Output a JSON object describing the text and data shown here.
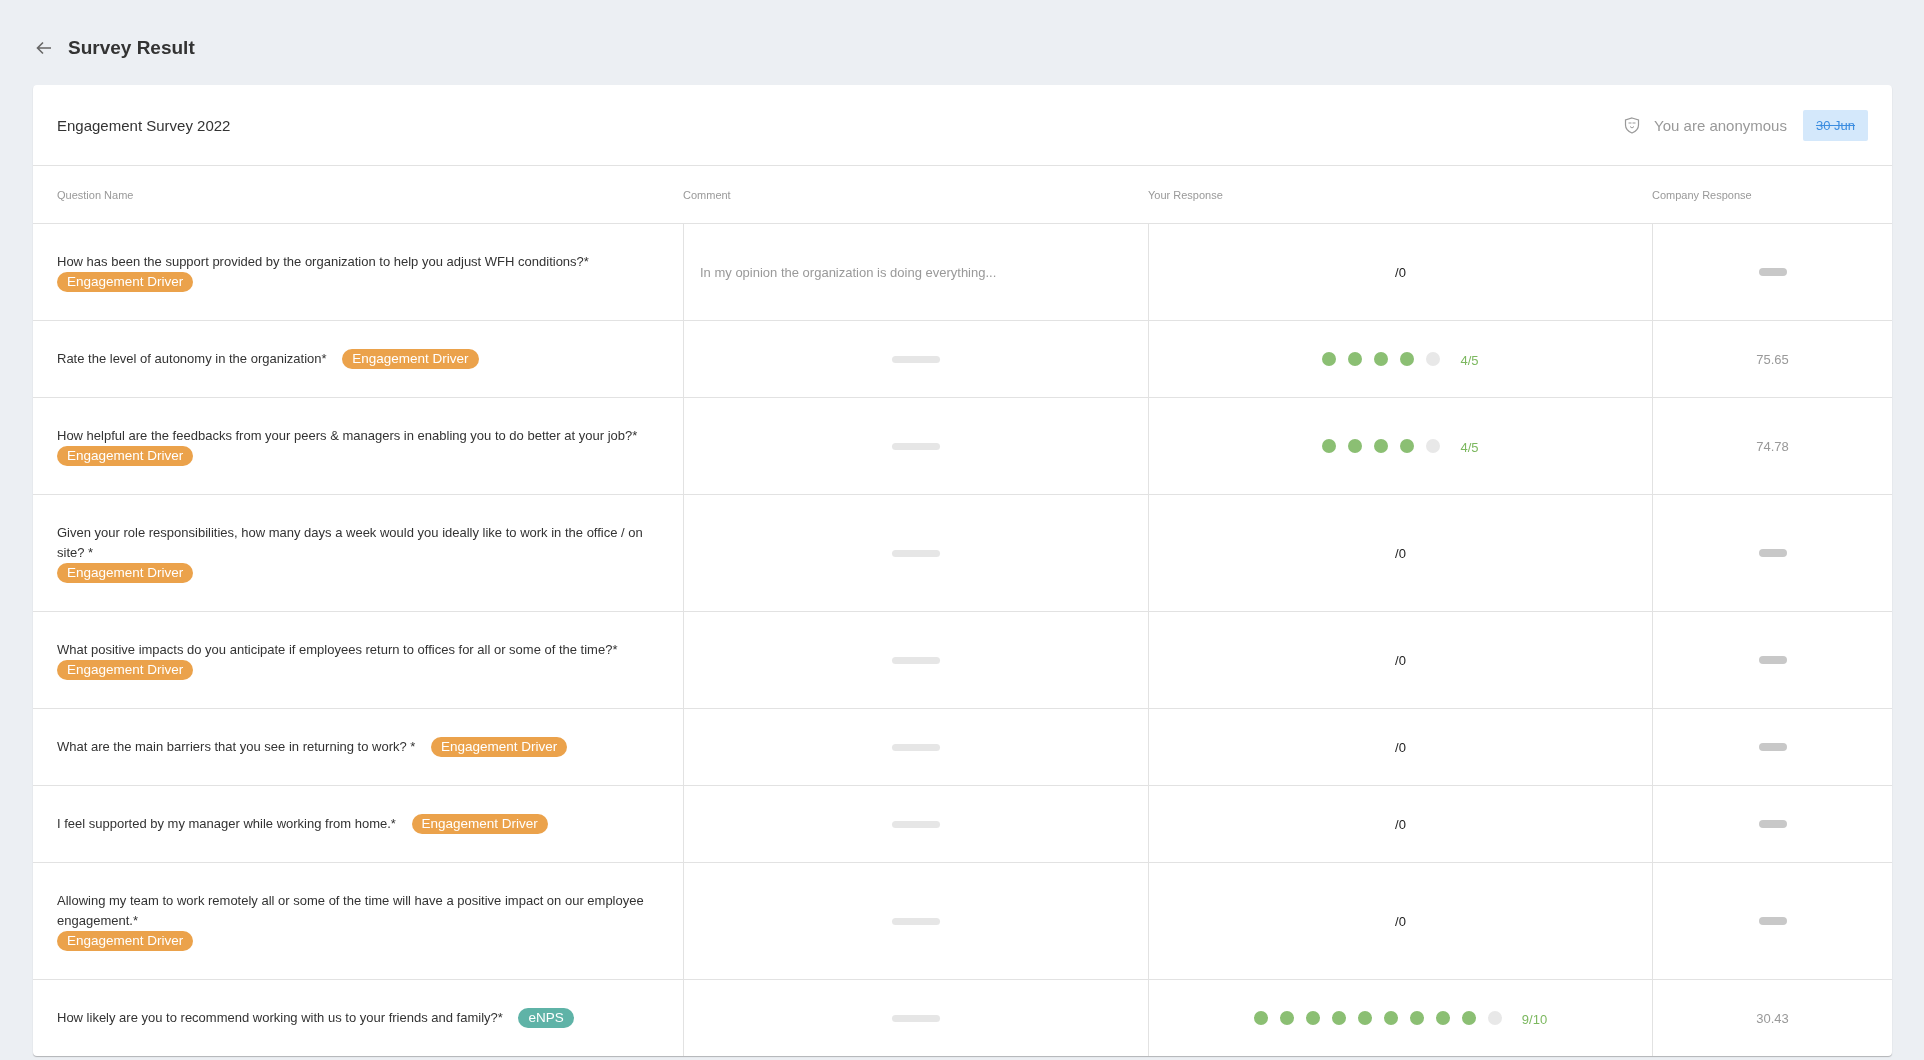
{
  "page": {
    "title": "Survey Result"
  },
  "survey": {
    "name": "Engagement Survey 2022",
    "anonymity": "You are anonymous",
    "date": {
      "label": "30 Jun",
      "struck": true
    }
  },
  "table": {
    "columns": [
      "Question Name",
      "Comment",
      "Your Response",
      "Company Response"
    ],
    "rows": [
      {
        "question": "How has been the support provided by the organization to help you adjust WFH conditions?*",
        "tag": {
          "label": "Engagement Driver",
          "color": "#eba24b"
        },
        "comment": "In my opinion the organization is doing everything...",
        "response": {
          "kind": "text",
          "value": "/0"
        }
      },
      {
        "question": "Rate the level of autonomy in the organization*",
        "tag": {
          "label": "Engagement Driver",
          "color": "#eba24b"
        },
        "response": {
          "kind": "rating",
          "points": [
            {
              "filled": true
            },
            {
              "filled": true
            },
            {
              "filled": true
            },
            {
              "filled": true
            },
            {
              "filled": false
            }
          ],
          "reading": "4/5"
        },
        "company": "75.65"
      },
      {
        "question": "How helpful are the feedbacks from your peers & managers in enabling you to do better at your job?*",
        "tag": {
          "label": "Engagement Driver",
          "color": "#eba24b"
        },
        "response": {
          "kind": "rating",
          "points": [
            {
              "filled": true
            },
            {
              "filled": true
            },
            {
              "filled": true
            },
            {
              "filled": true
            },
            {
              "filled": false
            }
          ],
          "reading": "4/5"
        },
        "company": "74.78"
      },
      {
        "question": "Given your role responsibilities, how many days a week would you ideally like to work in the office / on site? *",
        "tag": {
          "label": "Engagement Driver",
          "color": "#eba24b"
        },
        "response": {
          "kind": "text",
          "value": "/0"
        }
      },
      {
        "question": "What positive impacts do you anticipate if employees return to offices for all or some of the time?*",
        "tag": {
          "label": "Engagement Driver",
          "color": "#eba24b"
        },
        "response": {
          "kind": "text",
          "value": "/0"
        }
      },
      {
        "question": "What are the main barriers that you see in returning to work? *",
        "tag": {
          "label": "Engagement Driver",
          "color": "#eba24b"
        },
        "response": {
          "kind": "text",
          "value": "/0"
        }
      },
      {
        "question": "I feel supported by my manager while working from home.*",
        "tag": {
          "label": "Engagement Driver",
          "color": "#eba24b"
        },
        "response": {
          "kind": "text",
          "value": "/0"
        }
      },
      {
        "question": "Allowing my team to work remotely all or some of the time will have a positive impact on our employee engagement.*",
        "tag": {
          "label": "Engagement Driver",
          "color": "#eba24b"
        },
        "response": {
          "kind": "text",
          "value": "/0"
        }
      },
      {
        "question": "How likely are you to recommend working with us to your friends and family?*",
        "tag": {
          "label": "eNPS",
          "color": "#5fb3a7"
        },
        "response": {
          "kind": "rating",
          "points": [
            {
              "filled": true
            },
            {
              "filled": true
            },
            {
              "filled": true
            },
            {
              "filled": true
            },
            {
              "filled": true
            },
            {
              "filled": true
            },
            {
              "filled": true
            },
            {
              "filled": true
            },
            {
              "filled": true
            },
            {
              "filled": false
            }
          ],
          "reading": "9/10"
        },
        "company": "30.43"
      }
    ]
  }
}
